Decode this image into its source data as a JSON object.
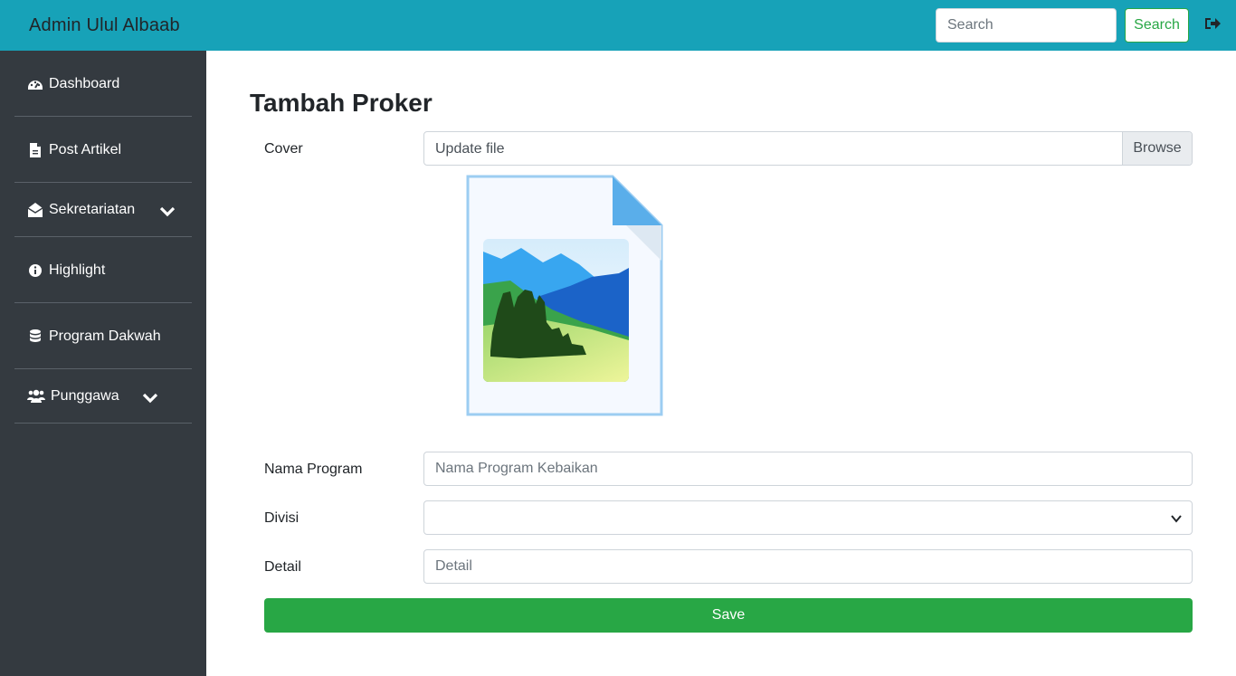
{
  "navbar": {
    "brand": "Admin Ulul Albaab",
    "search_placeholder": "Search",
    "search_button": "Search",
    "logout_icon": "sign-out-icon"
  },
  "sidebar": {
    "items": [
      {
        "label": "Dashboard",
        "icon": "tachometer-icon",
        "dropdown": false
      },
      {
        "label": "Post Artikel",
        "icon": "file-icon",
        "dropdown": false
      },
      {
        "label": "Sekretariatan",
        "icon": "envelope-open-icon",
        "dropdown": true
      },
      {
        "label": "Highlight",
        "icon": "info-circle-icon",
        "dropdown": false
      },
      {
        "label": "Program Dakwah",
        "icon": "database-icon",
        "dropdown": false
      },
      {
        "label": "Punggawa",
        "icon": "users-icon",
        "dropdown": true
      }
    ]
  },
  "main": {
    "title": "Tambah Proker",
    "cover": {
      "label": "Cover",
      "file_text": "Update file",
      "browse": "Browse"
    },
    "nama_program": {
      "label": "Nama Program",
      "placeholder": "Nama Program Kebaikan"
    },
    "divisi": {
      "label": "Divisi",
      "selected": ""
    },
    "detail": {
      "label": "Detail",
      "placeholder": "Detail"
    },
    "save": "Save"
  },
  "colors": {
    "navbar": "#17a2b8",
    "sidebar": "#343a40",
    "success": "#28a745"
  }
}
